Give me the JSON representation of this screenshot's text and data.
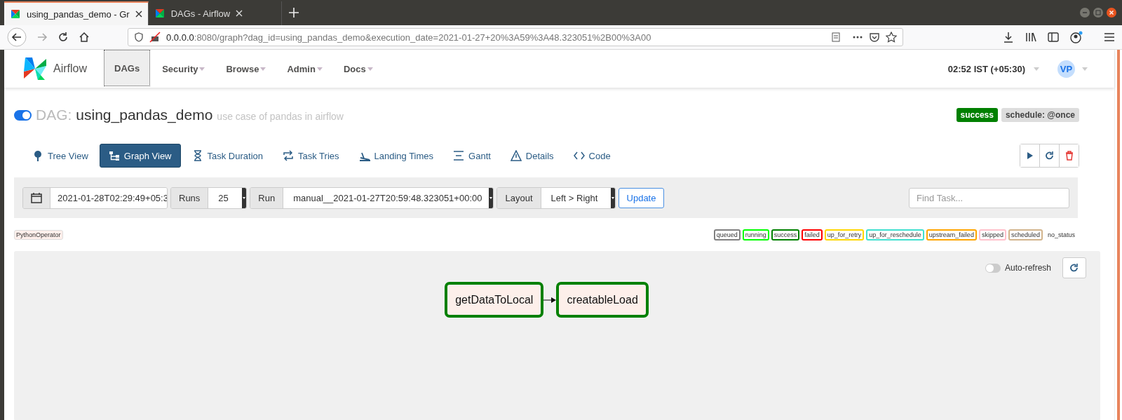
{
  "browser": {
    "tabs": [
      {
        "title": "using_pandas_demo - Gr",
        "selected": true
      },
      {
        "title": "DAGs - Airflow",
        "selected": false
      }
    ],
    "url_host": "0.0.0.0",
    "url_rest": ":8080/graph?dag_id=using_pandas_demo&execution_date=2021-01-27+20%3A59%3A48.323051%2B00%3A00"
  },
  "navbar": {
    "brand": "Airflow",
    "menu": [
      {
        "label": "DAGs",
        "selected": true,
        "dropdown": false
      },
      {
        "label": "Security",
        "selected": false,
        "dropdown": true
      },
      {
        "label": "Browse",
        "selected": false,
        "dropdown": true
      },
      {
        "label": "Admin",
        "selected": false,
        "dropdown": true
      },
      {
        "label": "Docs",
        "selected": false,
        "dropdown": true
      }
    ],
    "clock": "02:52 IST (+05:30)",
    "avatar": "VP"
  },
  "dag": {
    "on": true,
    "prefix": "DAG:",
    "name": "using_pandas_demo",
    "description": "use case of pandas in airflow",
    "status": "success",
    "schedule": "schedule: @once"
  },
  "views": [
    {
      "label": "Tree View",
      "selected": false
    },
    {
      "label": "Graph View",
      "selected": true
    },
    {
      "label": "Task Duration",
      "selected": false
    },
    {
      "label": "Task Tries",
      "selected": false
    },
    {
      "label": "Landing Times",
      "selected": false
    },
    {
      "label": "Gantt",
      "selected": false
    },
    {
      "label": "Details",
      "selected": false
    },
    {
      "label": "Code",
      "selected": false
    }
  ],
  "filters": {
    "date": "2021-01-28T02:29:49+05:3",
    "runs_label": "Runs",
    "runs": "25",
    "run_label": "Run",
    "run": "manual__2021-01-27T20:59:48.323051+00:00",
    "layout_label": "Layout",
    "layout": "Left > Right",
    "update": "Update",
    "find_placeholder": "Find Task..."
  },
  "operators": [
    {
      "label": "PythonOperator",
      "color": "#ffefeb"
    }
  ],
  "states": [
    {
      "label": "queued",
      "color": "#808080"
    },
    {
      "label": "running",
      "color": "#00ff00"
    },
    {
      "label": "success",
      "color": "#008000"
    },
    {
      "label": "failed",
      "color": "#ff0000"
    },
    {
      "label": "up_for_retry",
      "color": "#ffd700"
    },
    {
      "label": "up_for_reschedule",
      "color": "#40e0d0"
    },
    {
      "label": "upstream_failed",
      "color": "#ffa500"
    },
    {
      "label": "skipped",
      "color": "#ffc0cb"
    },
    {
      "label": "scheduled",
      "color": "#d2b48c"
    },
    {
      "label": "no_status"
    }
  ],
  "graph": {
    "auto_refresh": false,
    "auto_refresh_label": "Auto-refresh",
    "tasks": [
      {
        "label": "getDataToLocal",
        "color": "#008000"
      },
      {
        "label": "creatableLoad",
        "color": "#008000"
      }
    ]
  }
}
